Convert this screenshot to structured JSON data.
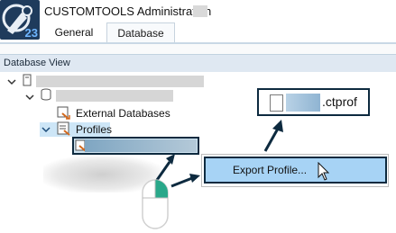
{
  "window": {
    "title": "CUSTOMTOOLS Administration",
    "app_icon_label": "23"
  },
  "tabs": [
    {
      "label": "General",
      "active": false
    },
    {
      "label": "Database",
      "active": true
    }
  ],
  "section": {
    "title": "Database View"
  },
  "tree": {
    "external_databases_label": "External Databases",
    "profiles_label": "Profiles"
  },
  "callout": {
    "extension": ".ctprof"
  },
  "context_menu": {
    "export_label": "Export Profile..."
  },
  "colors": {
    "accent_dark": "#0d2a3f",
    "selection_blue": "#a7d3f5",
    "mouse_button_highlight": "#29a88a"
  }
}
